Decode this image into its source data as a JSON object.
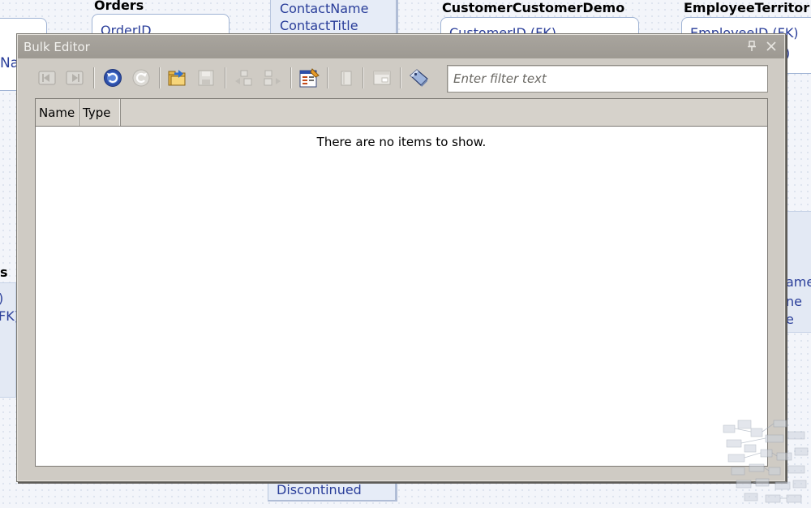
{
  "background": {
    "left_fragment_text": "Na",
    "orders_title": "Orders",
    "orders_field": "OrderID",
    "customer_fields": [
      "ContactName",
      "ContactTitle"
    ],
    "ccd_title": "CustomerCustomerDemo",
    "ccd_field": "CustomerID (FK)",
    "et_title": "EmployeeTerritor",
    "et_field": "EmployeeID (FK)",
    "et_field2": ")",
    "left_lower_title": "s",
    "left_lower_fields": [
      ")",
      "FK)"
    ],
    "right_lower_fields": [
      "ame",
      "ne",
      "e"
    ],
    "products_field": "Discontinued"
  },
  "dialog": {
    "title": "Bulk Editor",
    "pin_glyph": "📌",
    "close_glyph": "✕"
  },
  "toolbar": {
    "buttons": [
      {
        "name": "back-icon",
        "enabled": false
      },
      {
        "name": "forward-icon",
        "enabled": false
      },
      {
        "name": "undo-icon",
        "enabled": true
      },
      {
        "name": "redo-icon",
        "enabled": false
      },
      {
        "name": "open-folder-icon",
        "enabled": true
      },
      {
        "name": "save-icon",
        "enabled": false
      },
      {
        "name": "move-left-icon",
        "enabled": false
      },
      {
        "name": "move-right-icon",
        "enabled": false
      },
      {
        "name": "properties-icon",
        "enabled": true
      },
      {
        "name": "delete-icon",
        "enabled": false
      },
      {
        "name": "view-icon",
        "enabled": false
      },
      {
        "name": "tag-icon",
        "enabled": true
      }
    ]
  },
  "filter": {
    "placeholder": "Enter filter text",
    "value": ""
  },
  "list": {
    "columns": [
      "Name",
      "Type"
    ],
    "empty_message": "There are no items to show."
  },
  "colors": {
    "dialog_bg": "#cfcbc4",
    "titlebar": "#a39f98",
    "diagram_link": "#2a3e9a"
  }
}
